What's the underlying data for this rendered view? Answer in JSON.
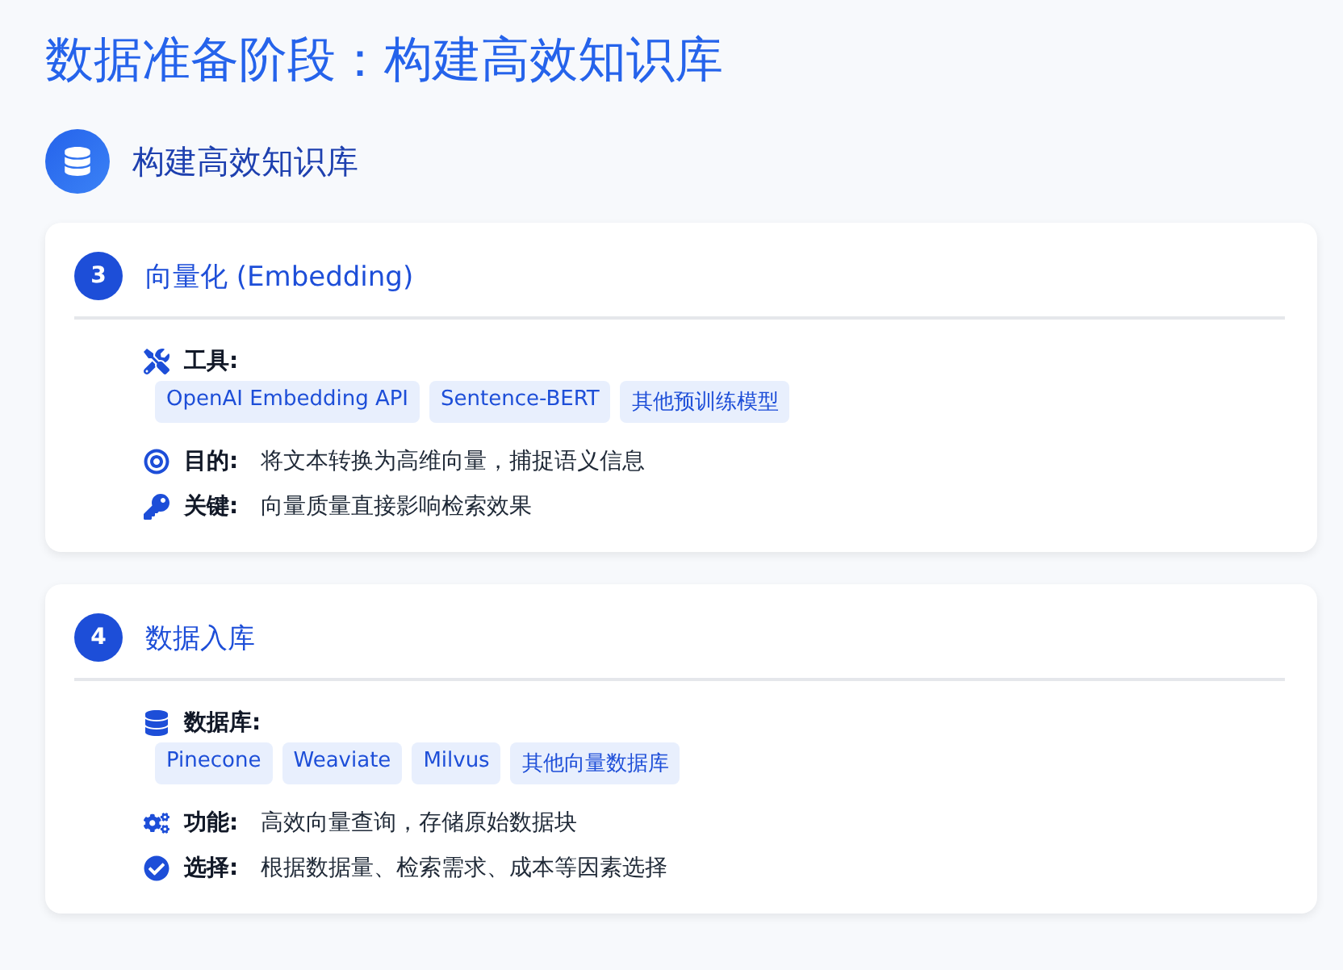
{
  "title": "数据准备阶段：构建高效知识库",
  "section": {
    "heading": "构建高效知识库"
  },
  "cards": [
    {
      "number": "3",
      "heading": "向量化 (Embedding)",
      "items": [
        {
          "kind": "tags",
          "label": "工具:",
          "tags": [
            "OpenAI Embedding API",
            "Sentence-BERT",
            "其他预训练模型"
          ]
        },
        {
          "kind": "text",
          "label": "目的:",
          "text": "将文本转换为高维向量，捕捉语义信息"
        },
        {
          "kind": "text",
          "label": "关键:",
          "text": "向量质量直接影响检索效果"
        }
      ]
    },
    {
      "number": "4",
      "heading": "数据入库",
      "items": [
        {
          "kind": "tags",
          "label": "数据库:",
          "tags": [
            "Pinecone",
            "Weaviate",
            "Milvus",
            "其他向量数据库"
          ]
        },
        {
          "kind": "text",
          "label": "功能:",
          "text": "高效向量查询，存储原始数据块"
        },
        {
          "kind": "text",
          "label": "选择:",
          "text": "根据数据量、检索需求、成本等因素选择"
        }
      ]
    }
  ]
}
